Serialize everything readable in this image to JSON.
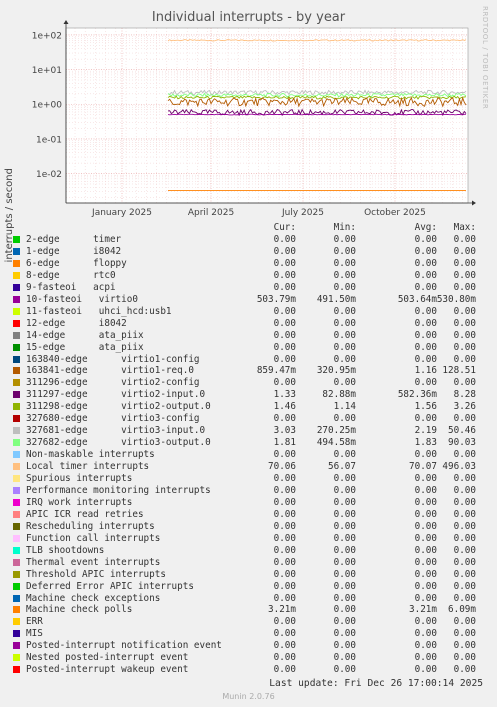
{
  "chart_data": {
    "type": "line",
    "title": "Individual interrupts - by year",
    "ylabel": "interrupts / second",
    "yscale": "log",
    "yticks": [
      "1e-02",
      "1e-01",
      "1e+00",
      "1e+01",
      "1e+02"
    ],
    "xticks": [
      "January 2025",
      "April 2025",
      "July 2025",
      "October 2025"
    ],
    "grid": true,
    "columns": [
      "Cur:",
      "Min:",
      "Avg:",
      "Max:"
    ],
    "series": [
      {
        "name": "2-edge      timer",
        "color": "#00cc00",
        "cur": "0.00",
        "min": "0.00",
        "avg": "0.00",
        "max": "0.00"
      },
      {
        "name": "1-edge      i8042",
        "color": "#0066b3",
        "cur": "0.00",
        "min": "0.00",
        "avg": "0.00",
        "max": "0.00"
      },
      {
        "name": "6-edge      floppy",
        "color": "#ff8000",
        "cur": "0.00",
        "min": "0.00",
        "avg": "0.00",
        "max": "0.00"
      },
      {
        "name": "8-edge      rtc0",
        "color": "#ffcc00",
        "cur": "0.00",
        "min": "0.00",
        "avg": "0.00",
        "max": "0.00"
      },
      {
        "name": "9-fasteoi   acpi",
        "color": "#330099",
        "cur": "0.00",
        "min": "0.00",
        "avg": "0.00",
        "max": "0.00"
      },
      {
        "name": "10-fasteoi   virtio0",
        "color": "#990099",
        "cur": "503.79m",
        "min": "491.50m",
        "avg": "503.64m",
        "max": "530.80m"
      },
      {
        "name": "11-fasteoi   uhci_hcd:usb1",
        "color": "#ccff00",
        "cur": "0.00",
        "min": "0.00",
        "avg": "0.00",
        "max": "0.00"
      },
      {
        "name": "12-edge      i8042",
        "color": "#ff0000",
        "cur": "0.00",
        "min": "0.00",
        "avg": "0.00",
        "max": "0.00"
      },
      {
        "name": "14-edge      ata_piix",
        "color": "#808080",
        "cur": "0.00",
        "min": "0.00",
        "avg": "0.00",
        "max": "0.00"
      },
      {
        "name": "15-edge      ata_piix",
        "color": "#008f00",
        "cur": "0.00",
        "min": "0.00",
        "avg": "0.00",
        "max": "0.00"
      },
      {
        "name": "163840-edge      virtio1-config",
        "color": "#00487d",
        "cur": "0.00",
        "min": "0.00",
        "avg": "0.00",
        "max": "0.00"
      },
      {
        "name": "163841-edge      virtio1-req.0",
        "color": "#b35a00",
        "cur": "859.47m",
        "min": "320.95m",
        "avg": "1.16",
        "max": "128.51"
      },
      {
        "name": "311296-edge      virtio2-config",
        "color": "#b38f00",
        "cur": "0.00",
        "min": "0.00",
        "avg": "0.00",
        "max": "0.00"
      },
      {
        "name": "311297-edge      virtio2-input.0",
        "color": "#6b006b",
        "cur": "1.33",
        "min": "82.88m",
        "avg": "582.36m",
        "max": "8.28"
      },
      {
        "name": "311298-edge      virtio2-output.0",
        "color": "#8fb300",
        "cur": "1.46",
        "min": "1.14",
        "avg": "1.56",
        "max": "3.26"
      },
      {
        "name": "327680-edge      virtio3-config",
        "color": "#b30000",
        "cur": "0.00",
        "min": "0.00",
        "avg": "0.00",
        "max": "0.00"
      },
      {
        "name": "327681-edge      virtio3-input.0",
        "color": "#bebebe",
        "cur": "3.03",
        "min": "270.25m",
        "avg": "2.19",
        "max": "50.46"
      },
      {
        "name": "327682-edge      virtio3-output.0",
        "color": "#80ff80",
        "cur": "1.81",
        "min": "494.58m",
        "avg": "1.83",
        "max": "90.03"
      },
      {
        "name": "Non-maskable interrupts",
        "color": "#80c9ff",
        "cur": "0.00",
        "min": "0.00",
        "avg": "0.00",
        "max": "0.00"
      },
      {
        "name": "Local timer interrupts",
        "color": "#ffc080",
        "cur": "70.06",
        "min": "56.07",
        "avg": "70.07",
        "max": "496.03"
      },
      {
        "name": "Spurious interrupts",
        "color": "#ffe680",
        "cur": "0.00",
        "min": "0.00",
        "avg": "0.00",
        "max": "0.00"
      },
      {
        "name": "Performance monitoring interrupts",
        "color": "#aa80ff",
        "cur": "0.00",
        "min": "0.00",
        "avg": "0.00",
        "max": "0.00"
      },
      {
        "name": "IRQ work interrupts",
        "color": "#ee00cc",
        "cur": "0.00",
        "min": "0.00",
        "avg": "0.00",
        "max": "0.00"
      },
      {
        "name": "APIC ICR read retries",
        "color": "#ff8080",
        "cur": "0.00",
        "min": "0.00",
        "avg": "0.00",
        "max": "0.00"
      },
      {
        "name": "Rescheduling interrupts",
        "color": "#666600",
        "cur": "0.00",
        "min": "0.00",
        "avg": "0.00",
        "max": "0.00"
      },
      {
        "name": "Function call interrupts",
        "color": "#ffbfff",
        "cur": "0.00",
        "min": "0.00",
        "avg": "0.00",
        "max": "0.00"
      },
      {
        "name": "TLB shootdowns",
        "color": "#00ffcc",
        "cur": "0.00",
        "min": "0.00",
        "avg": "0.00",
        "max": "0.00"
      },
      {
        "name": "Thermal event interrupts",
        "color": "#cc6699",
        "cur": "0.00",
        "min": "0.00",
        "avg": "0.00",
        "max": "0.00"
      },
      {
        "name": "Threshold APIC interrupts",
        "color": "#999900",
        "cur": "0.00",
        "min": "0.00",
        "avg": "0.00",
        "max": "0.00"
      },
      {
        "name": "Deferred Error APIC interrupts",
        "color": "#00cc00",
        "cur": "0.00",
        "min": "0.00",
        "avg": "0.00",
        "max": "0.00"
      },
      {
        "name": "Machine check exceptions",
        "color": "#0066b3",
        "cur": "0.00",
        "min": "0.00",
        "avg": "0.00",
        "max": "0.00"
      },
      {
        "name": "Machine check polls",
        "color": "#ff8000",
        "cur": "3.21m",
        "min": "0.00",
        "avg": "3.21m",
        "max": "6.09m"
      },
      {
        "name": "ERR",
        "color": "#ffcc00",
        "cur": "0.00",
        "min": "0.00",
        "avg": "0.00",
        "max": "0.00"
      },
      {
        "name": "MIS",
        "color": "#330099",
        "cur": "0.00",
        "min": "0.00",
        "avg": "0.00",
        "max": "0.00"
      },
      {
        "name": "Posted-interrupt notification event",
        "color": "#990099",
        "cur": "0.00",
        "min": "0.00",
        "avg": "0.00",
        "max": "0.00"
      },
      {
        "name": "Nested posted-interrupt event",
        "color": "#ccff00",
        "cur": "0.00",
        "min": "0.00",
        "avg": "0.00",
        "max": "0.00"
      },
      {
        "name": "Posted-interrupt wakeup event",
        "color": "#ff0000",
        "cur": "0.00",
        "min": "0.00",
        "avg": "0.00",
        "max": "0.00"
      }
    ]
  },
  "watermark": "RRDTOOL / TOBI OETIKER",
  "last_update": "Last update: Fri Dec 26 17:00:14 2025",
  "footer": "Munin 2.0.76"
}
